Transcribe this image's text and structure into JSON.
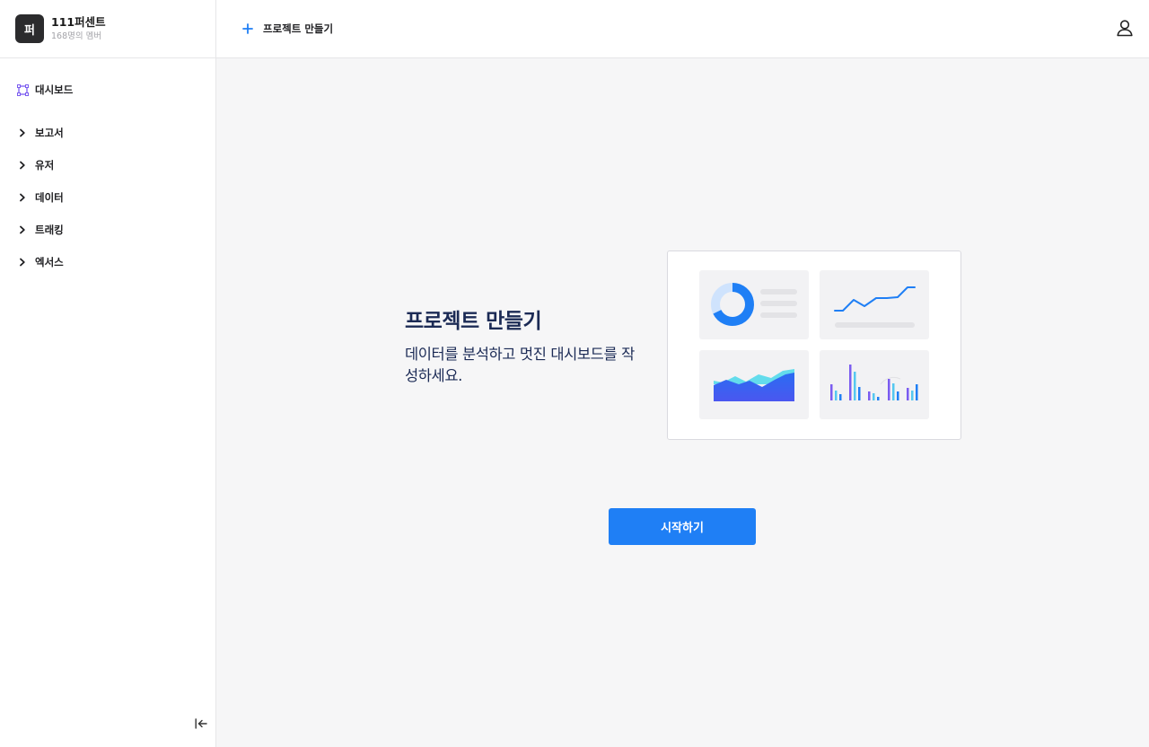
{
  "workspace": {
    "avatar_letter": "퍼",
    "name": "111퍼센트",
    "members": "168명의 멤버"
  },
  "sidebar": {
    "items": [
      {
        "label": "대시보드",
        "icon": "dashboard-icon",
        "active": true
      },
      {
        "label": "보고서",
        "icon": "chevron-right-icon"
      },
      {
        "label": "유저",
        "icon": "chevron-right-icon"
      },
      {
        "label": "데이터",
        "icon": "chevron-right-icon"
      },
      {
        "label": "트래킹",
        "icon": "chevron-right-icon"
      },
      {
        "label": "엑서스",
        "icon": "chevron-right-icon"
      }
    ],
    "collapse_icon": "collapse-sidebar-icon"
  },
  "topbar": {
    "new_project_label": "프로젝트 만들기",
    "user_icon": "user-icon"
  },
  "main": {
    "title": "프로젝트 만들기",
    "description": "데이터를 분석하고 멋진 대시보드를 작성하세요.",
    "start_button": "시작하기"
  },
  "colors": {
    "accent": "#1f7ff5",
    "title": "#1b2a55",
    "dashboard_icon": "#7b5cf0",
    "sidebar_bg": "#ffffff",
    "main_bg": "#f6f6f7"
  }
}
